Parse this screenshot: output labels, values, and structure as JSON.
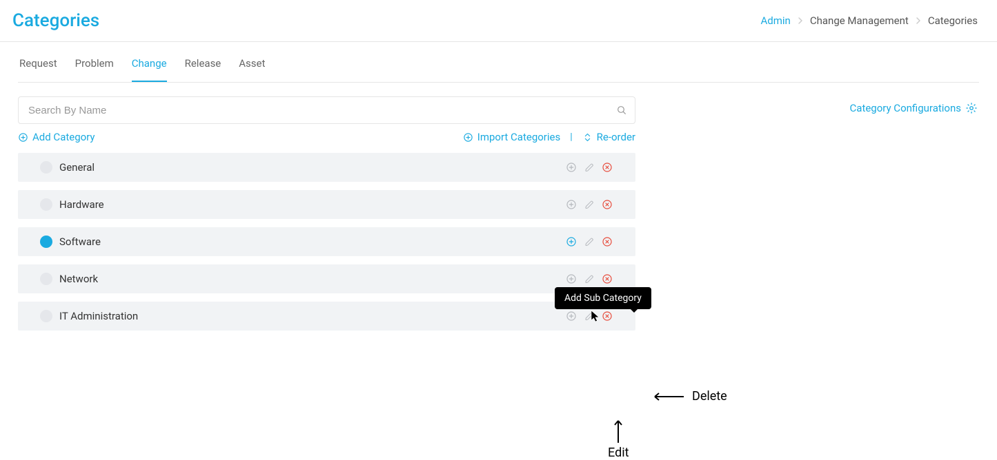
{
  "header": {
    "title": "Categories",
    "breadcrumb": [
      "Admin",
      "Change Management",
      "Categories"
    ]
  },
  "tabs": [
    "Request",
    "Problem",
    "Change",
    "Release",
    "Asset"
  ],
  "active_tab": "Change",
  "search": {
    "placeholder": "Search By Name"
  },
  "actions": {
    "add": "Add Category",
    "import": "Import Categories",
    "reorder": "Re-order"
  },
  "config_link": "Category Configurations",
  "categories": [
    {
      "name": "General",
      "active": false,
      "add_highlight": false
    },
    {
      "name": "Hardware",
      "active": false,
      "add_highlight": false
    },
    {
      "name": "Software",
      "active": true,
      "add_highlight": true
    },
    {
      "name": "Network",
      "active": false,
      "add_highlight": false
    },
    {
      "name": "IT Administration",
      "active": false,
      "add_highlight": false
    }
  ],
  "tooltip": "Add Sub Category",
  "annotations": {
    "delete": "Delete",
    "edit": "Edit"
  }
}
